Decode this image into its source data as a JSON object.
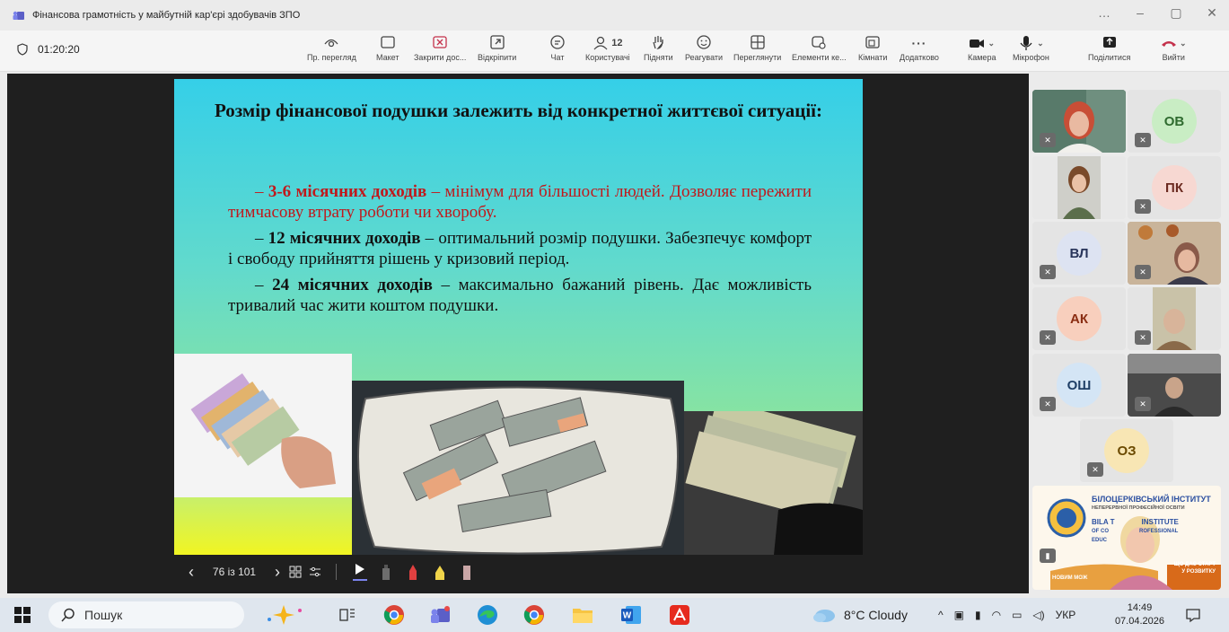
{
  "window": {
    "title": "Фінансова грамотність у майбутній кар'єрі здобувачів ЗПО",
    "controls": [
      "…",
      "–",
      "▢",
      "✕"
    ]
  },
  "toolbar": {
    "timer": "01:20:20",
    "buttons": {
      "preview": "Пр. перегляд",
      "layout": "Макет",
      "close_share": "Закрити дос...",
      "unpin": "Відкріпити",
      "chat": "Чат",
      "people": "Користувачі",
      "people_count": "12",
      "raise": "Підняти",
      "react": "Реагувати",
      "view": "Переглянути",
      "apps": "Елементи ке...",
      "rooms": "Кімнати",
      "more": "Додатково",
      "camera": "Камера",
      "mic": "Мікрофон",
      "share": "Поділитися",
      "leave": "Вийти"
    },
    "colors": {
      "leave": "#c4314b",
      "close_share": "#c4314b"
    }
  },
  "slide": {
    "title": "Розмір фінансової подушки залежить від конкретної життєвої ситуації:",
    "items": [
      {
        "dash": "– ",
        "bold": "3-6 місячних доходів",
        "text": " – мінімум для більшості людей. Дозволяє пережити тимчасову втрату роботи чи хворобу.",
        "red": true
      },
      {
        "dash": "– ",
        "bold": "12 місячних доходів",
        "text": " – оптимальний розмір подушки. Забезпечує комфорт і свободу прийняття рішень у кризовий період.",
        "red": false
      },
      {
        "dash": "– ",
        "bold": "24 місячних доходів",
        "text": " – максимально бажаний рівень. Дає можливість тривалий час жити коштом подушки.",
        "red": false
      }
    ],
    "images": [
      "hand-with-banknotes",
      "pillow-of-cash",
      "hryvnia-wallet"
    ]
  },
  "slide_controls": {
    "prev": "‹",
    "page": "76 із 101",
    "next": "›"
  },
  "participants": [
    {
      "initials": "ОВ",
      "color": "#c9edc4",
      "text_color": "#2f6b2f"
    },
    {
      "initials": "ПК",
      "color": "#f7d8d2",
      "text_color": "#6b2a20"
    },
    {
      "initials": "ВЛ",
      "color": "#dde3f2",
      "text_color": "#28345a"
    },
    {
      "initials": "АК",
      "color": "#f8cfbd",
      "text_color": "#8a2d12"
    },
    {
      "initials": "ОШ",
      "color": "#d4e5f5",
      "text_color": "#1f3f66"
    },
    {
      "initials": "ОЗ",
      "color": "#f8e6b4",
      "text_color": "#6b4a00"
    }
  ],
  "institute": {
    "line1": "БІЛОЦЕРКІВСЬКИЙ ІНСТИТУТ",
    "line2": "НЕПЕРЕРВНОЇ ПРОФЕСІЙНОЇ ОСВІТИ",
    "line3": "BILA T",
    "line3b": "INSTITUTE",
    "line4": "OF CO",
    "line4b": "ROFESSIONAL",
    "line5": "EDUC",
    "slogan1": "ЩО ДАЄ СТАРТ",
    "slogan2": "НОВИМ МОЖ",
    "slogan3": "У РОЗВИТКУ"
  },
  "taskbar": {
    "search": "Пошук",
    "weather": "8°C  Cloudy",
    "lang": "УКР",
    "time": "14:49",
    "date": "07.04.2026"
  }
}
